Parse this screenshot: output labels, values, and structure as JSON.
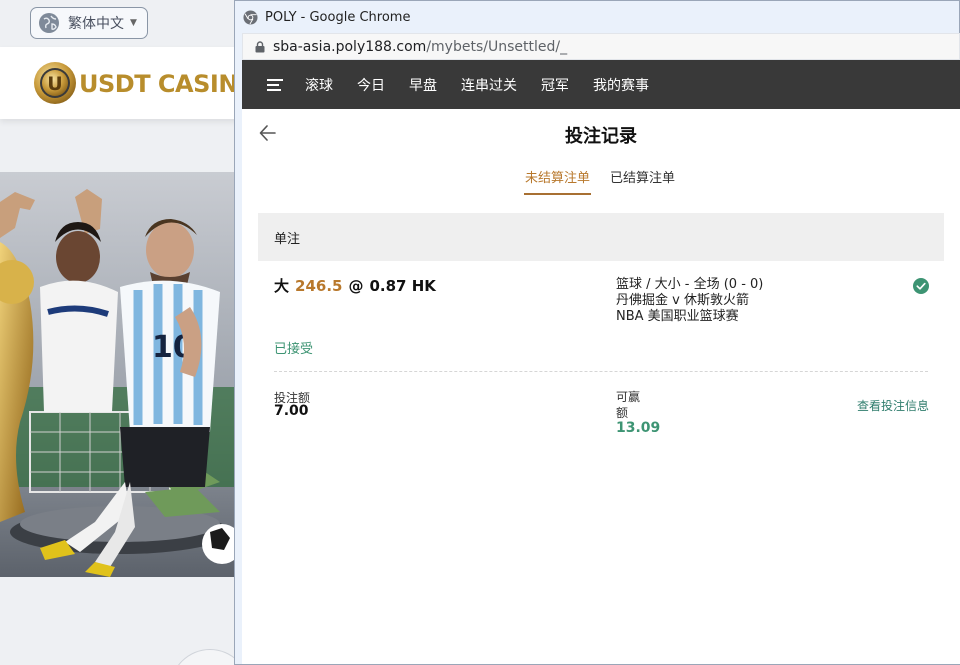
{
  "background_site": {
    "language_label": "繁体中文",
    "logo_text": "USDT CASINO",
    "logo_emblem_letter": "U",
    "jersey_number": "10"
  },
  "window": {
    "title": "POLY - Google Chrome",
    "url_host": "sba-asia.poly188.com",
    "url_path": "/mybets/Unsettled/_"
  },
  "nav": {
    "items": [
      "滚球",
      "今日",
      "早盘",
      "连串过关",
      "冠军",
      "我的赛事"
    ]
  },
  "page": {
    "title": "投注记录",
    "tabs": [
      {
        "label": "未结算注单",
        "active": true
      },
      {
        "label": "已结算注单",
        "active": false
      }
    ],
    "section_title": "单注"
  },
  "bet": {
    "selection": "大",
    "handicap": "246.5",
    "at": "@",
    "odds": "0.87 HK",
    "market": "篮球 / 大小 - 全场 (0 - 0)",
    "match": "丹佛掘金 v 休斯敦火箭",
    "league": "NBA 美国职业篮球赛",
    "status": "已接受",
    "stake_label": "投注额",
    "stake_value": "7.00",
    "win_label": "可赢额",
    "win_value": "13.09",
    "detail_link": "查看投注信息"
  },
  "colors": {
    "nav_bg": "#393939",
    "accent": "#b8782c",
    "success": "#3d9473",
    "link": "#2f7d6d"
  }
}
